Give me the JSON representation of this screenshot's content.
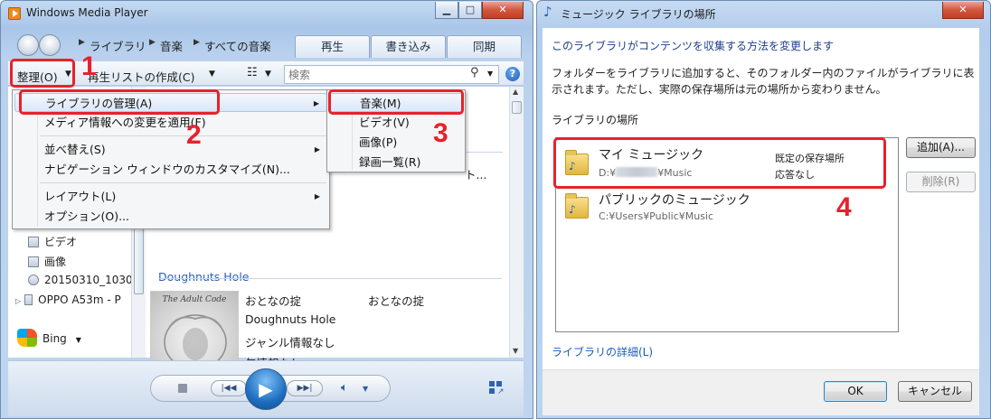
{
  "wmp": {
    "title": "Windows Media Player",
    "breadcrumb": [
      "ライブラリ",
      "音楽",
      "すべての音楽"
    ],
    "tabs": [
      "再生",
      "書き込み",
      "同期"
    ],
    "cmdbar": {
      "organize": "整理(O)",
      "create_playlist": "再生リストの作成(C)",
      "search_placeholder": "検索"
    },
    "organize_menu": [
      "ライブラリの管理(A)",
      "メディア情報への変更を適用(F)",
      "並べ替え(S)",
      "ナビゲーション ウィンドウのカスタマイズ(N)...",
      "レイアウト(L)",
      "オプション(O)..."
    ],
    "manage_submenu": [
      "音楽(M)",
      "ビデオ(V)",
      "画像(P)",
      "録画一覧(R)"
    ],
    "nav": [
      "ビデオ",
      "画像",
      "20150310_1030",
      "OPPO A53m - P",
      "Bing"
    ],
    "album": {
      "group_title": "Doughnuts Hole",
      "art_text": "The Adult Code",
      "details": [
        "おとなの掟",
        "Doughnuts Hole",
        "ジャンル情報なし",
        "年情報なし"
      ],
      "title_col": "おとなの掟",
      "partial_column": "ト..."
    }
  },
  "steps": [
    "1",
    "2",
    "3",
    "4"
  ],
  "dialog": {
    "title": "ミュージック ライブラリの場所",
    "heading": "このライブラリがコンテンツを収集する方法を変更します",
    "description": "フォルダーをライブラリに追加すると、そのフォルダー内のファイルがライブラリに表示されます。ただし、実際の保存場所は元の場所から変わりません。",
    "locations_label": "ライブラリの場所",
    "locations": [
      {
        "name": "マイ ミュージック",
        "path_prefix": "D:¥",
        "path_suffix": "¥Music",
        "status1": "既定の保存場所",
        "status2": "応答なし"
      },
      {
        "name": "パブリックのミュージック",
        "path": "C:¥Users¥Public¥Music"
      }
    ],
    "add_button": "追加(A)...",
    "remove_button": "削除(R)",
    "details_link": "ライブラリの詳細(L)",
    "ok": "OK",
    "cancel": "キャンセル"
  },
  "colors": {
    "highlight": "#e8212b",
    "link": "#1a5fb4",
    "heading": "#1e3f8a"
  }
}
